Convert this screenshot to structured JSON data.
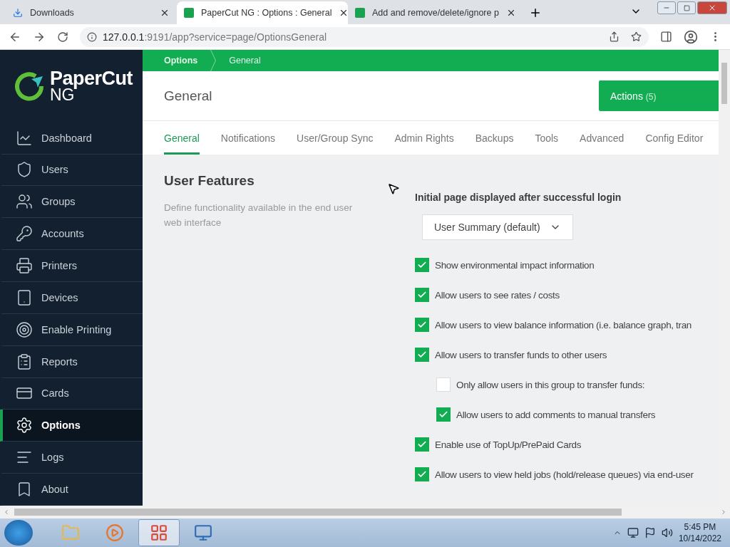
{
  "browser": {
    "tabs": [
      {
        "title": "Downloads",
        "selected": false
      },
      {
        "title": "PaperCut NG : Options : General",
        "selected": true
      },
      {
        "title": "Add and remove/delete/ignore p",
        "selected": false
      }
    ],
    "url_host": "127.0.0.1",
    "url_rest": ":9191/app?service=page/OptionsGeneral"
  },
  "sidebar": {
    "logo": {
      "name": "PaperCut",
      "suffix": "NG"
    },
    "items": [
      {
        "label": "Dashboard",
        "selected": false
      },
      {
        "label": "Users",
        "selected": false
      },
      {
        "label": "Groups",
        "selected": false
      },
      {
        "label": "Accounts",
        "selected": false
      },
      {
        "label": "Printers",
        "selected": false
      },
      {
        "label": "Devices",
        "selected": false
      },
      {
        "label": "Enable Printing",
        "selected": false
      },
      {
        "label": "Reports",
        "selected": false
      },
      {
        "label": "Cards",
        "selected": false
      },
      {
        "label": "Options",
        "selected": true
      },
      {
        "label": "Logs",
        "selected": false
      },
      {
        "label": "About",
        "selected": false
      }
    ]
  },
  "breadcrumb": [
    "Options",
    "General"
  ],
  "header": {
    "title": "General",
    "actions_label": "Actions",
    "actions_count": "(5)"
  },
  "tabs": [
    {
      "label": "General",
      "selected": true
    },
    {
      "label": "Notifications",
      "selected": false
    },
    {
      "label": "User/Group Sync",
      "selected": false
    },
    {
      "label": "Admin Rights",
      "selected": false
    },
    {
      "label": "Backups",
      "selected": false
    },
    {
      "label": "Tools",
      "selected": false
    },
    {
      "label": "Advanced",
      "selected": false
    },
    {
      "label": "Config Editor",
      "selected": false
    }
  ],
  "section": {
    "title": "User Features",
    "description": "Define functionality available in the end user web interface",
    "select_label": "Initial page displayed after successful login",
    "select_value": "User Summary (default)",
    "options": [
      {
        "label": "Show environmental impact information",
        "checked": true
      },
      {
        "label": "Allow users to see rates / costs",
        "checked": true
      },
      {
        "label": "Allow users to view balance information (i.e. balance graph, tran",
        "checked": true
      },
      {
        "label": "Allow users to transfer funds to other users",
        "checked": true,
        "children": [
          {
            "label": "Only allow users in this group to transfer funds:",
            "checked": false
          },
          {
            "label": "Allow users to add comments to manual transfers",
            "checked": true
          }
        ]
      },
      {
        "label": "Enable use of TopUp/PrePaid Cards",
        "checked": true
      },
      {
        "label": "Allow users to view held jobs (hold/release queues) via end-user",
        "checked": true
      }
    ]
  },
  "taskbar": {
    "apps": [
      {
        "selected": false
      },
      {
        "selected": false
      },
      {
        "selected": true
      },
      {
        "selected": false
      }
    ],
    "time": "5:45 PM",
    "date": "10/14/2022"
  }
}
